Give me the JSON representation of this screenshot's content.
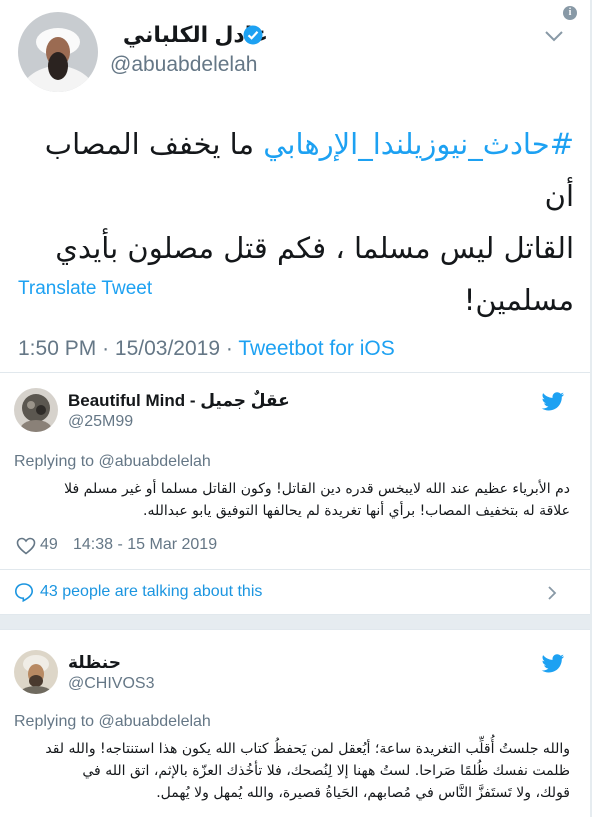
{
  "tweet": {
    "author_name": "عادل الكلباني",
    "author_handle": "@abuabdelelah",
    "hashtag": "#حادث_نيوزيلندا_الإرهابي",
    "text_line1_rest": " ما يخفف المصاب أن",
    "text_line2": "القاتل ليس مسلما ، فكم قتل مصلون بأيدي",
    "text_line3": "مسلمين!",
    "translate_label": "Translate Tweet",
    "time": "1:50 PM",
    "date": "15/03/2019",
    "separator": "·",
    "source": "Tweetbot for iOS"
  },
  "replies": [
    {
      "name": "Beautiful Mind - عقلٌ جميل",
      "handle": "@25M99",
      "replying_to": "Replying to @abuabdelelah",
      "text_line1": "دم الأبرياء عظيم عند الله لايبخس قدره دين القاتل! وكون القاتل مسلما أو غير مسلم فلا",
      "text_line2": "علاقة له بتخفيف المصاب! برأي أنها تغريدة لم يحالفها التوفيق يابو عبدالله.",
      "likes": "49",
      "timestamp": "14:38 - 15 Mar 2019"
    },
    {
      "name": "حنظلة",
      "handle": "@CHIVOS3",
      "replying_to": "Replying to @abuabdelelah",
      "text_line1": "والله جلستُ أُقلِّب التغريدة ساعة؛ أيُعقل لمن يَحفظُ كتاب الله يكون هذا استنتاجه! والله لقد",
      "text_line2": "ظلمت نفسك ظُلمًا صَراحا. لستُ ههنا إلا لِنُصحك، فلا تأخُذك العزّة بالإثم، اتق الله في",
      "text_line3": "قولك، ولا تَستَفزَّ النَّاس في مُصابهم، الحَياةُ قصيرة، والله يُمهل ولا يُهمل."
    }
  ],
  "conversation": {
    "label": "43 people are talking about this"
  },
  "colors": {
    "accent": "#1da1f2",
    "secondary_text": "#657786",
    "divider": "#e1e8ed"
  },
  "icons": [
    "info-icon",
    "chevron-down-icon",
    "verified-icon",
    "twitter-bird-icon",
    "heart-icon",
    "chat-bubble-icon",
    "chevron-right-icon"
  ]
}
